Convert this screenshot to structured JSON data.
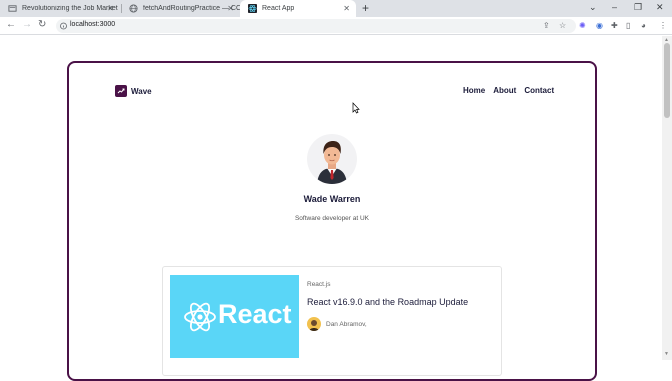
{
  "browser": {
    "tabs": [
      {
        "title": "Revolutionizing the Job Market |"
      },
      {
        "title": "fetchAndRoutingPractice — CC3..."
      },
      {
        "title": "React App"
      }
    ],
    "url": "localhost:3000",
    "colors": {
      "tabbar": "#dee1e6",
      "omnibox": "#f1f3f4"
    }
  },
  "page": {
    "brand": {
      "name": "Wave"
    },
    "nav": [
      {
        "label": "Home"
      },
      {
        "label": "About"
      },
      {
        "label": "Contact"
      }
    ],
    "profile": {
      "name": "Wade Warren",
      "bio": "Software developer at UK"
    },
    "post": {
      "image_text": "React",
      "tag": "React.js",
      "title": "React v16.9.0 and the Roadmap Update",
      "author": "Dan Abramov,"
    },
    "colors": {
      "accent": "#4a1247",
      "text": "#1c1c3a",
      "react_blue": "#5ad6f7"
    }
  }
}
